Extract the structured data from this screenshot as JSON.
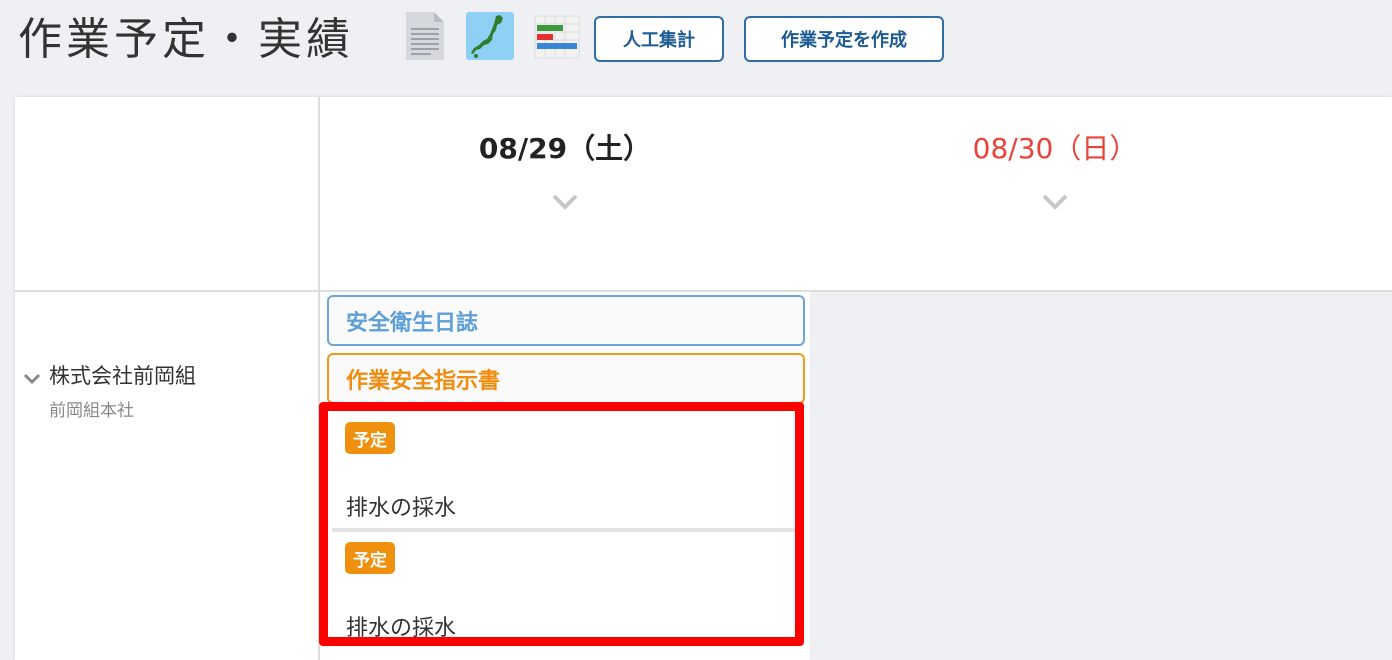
{
  "header": {
    "title": "作業予定・実績",
    "icons": [
      "document-icon",
      "japan-map-icon",
      "gantt-chart-icon"
    ],
    "buttons": {
      "manpower": "人工集計",
      "create_plan": "作業予定を作成"
    }
  },
  "dates": [
    {
      "label": "08/29（土）",
      "color": "#222222"
    },
    {
      "label": "08/30（日）",
      "color": "#e8423a"
    }
  ],
  "company": {
    "name": "株式会社前岡組",
    "branch": "前岡組本社"
  },
  "day_cell": {
    "docs": {
      "safety_journal": "安全衛生日誌",
      "safety_instruction": "作業安全指示書"
    },
    "tasks": [
      {
        "badge": "予定",
        "title": "排水の採水"
      },
      {
        "badge": "予定",
        "title": "排水の採水"
      }
    ]
  },
  "colors": {
    "accent_blue": "#2f6da3",
    "safety_blue": "#5d9fd6",
    "orange": "#f0900f",
    "sunday_red": "#e8423a",
    "highlight": "#ff0000"
  }
}
